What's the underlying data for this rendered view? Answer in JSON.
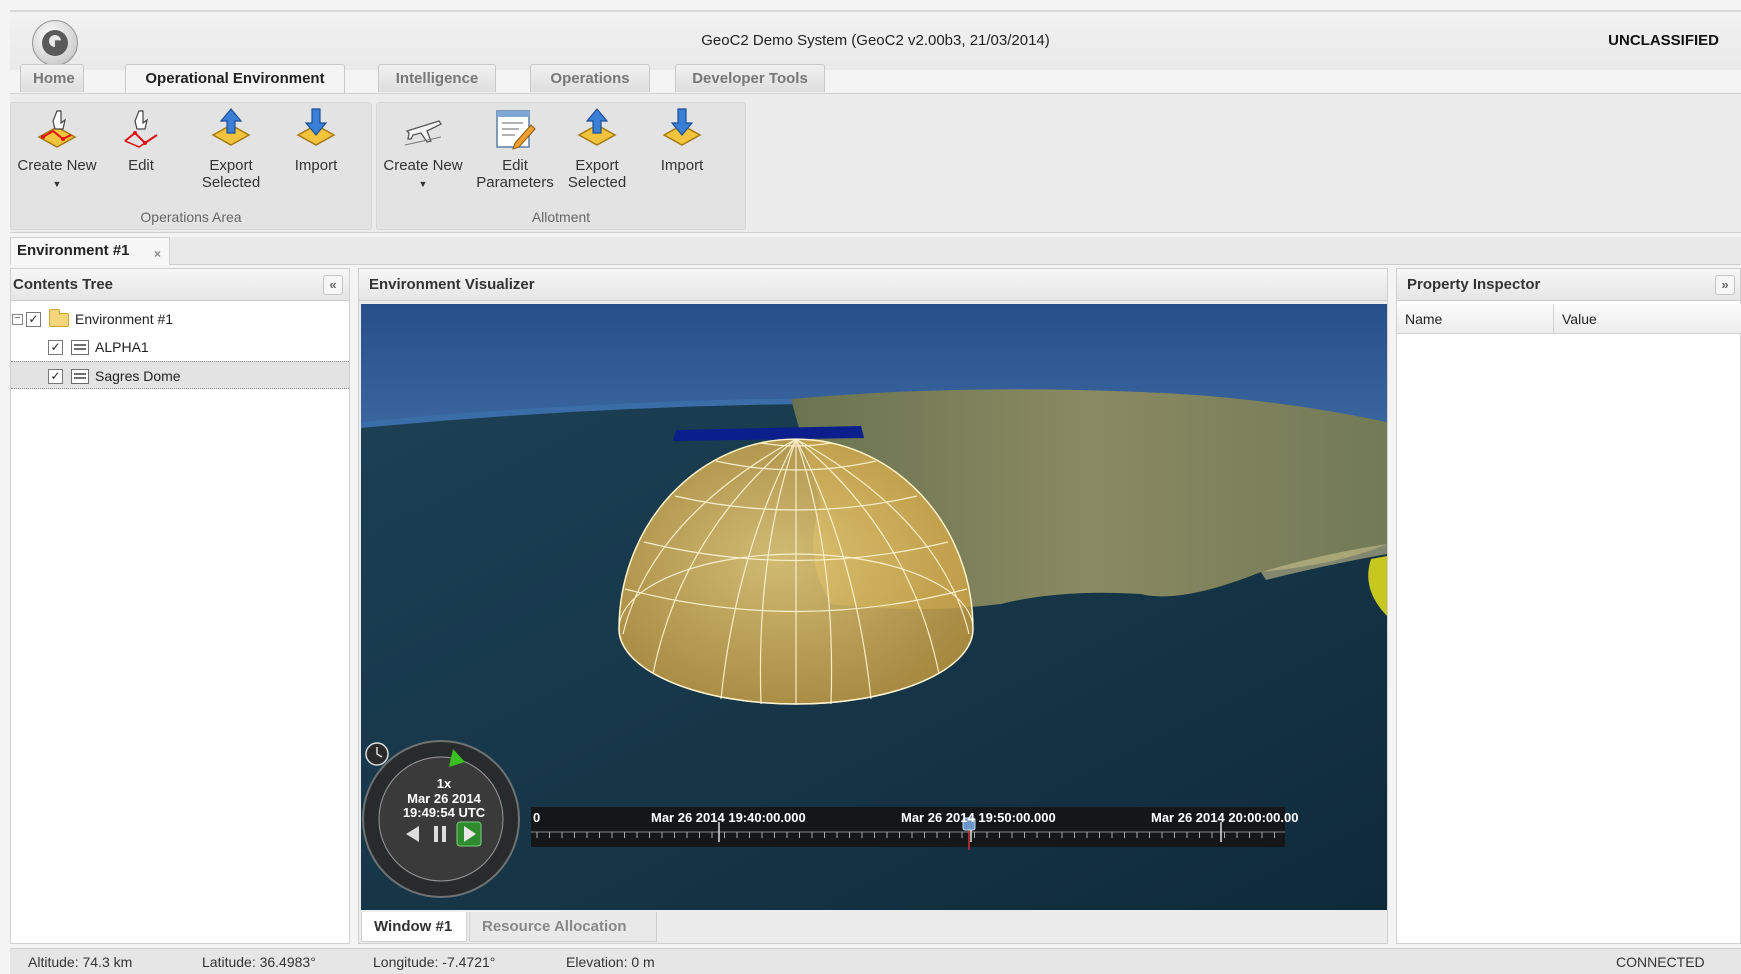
{
  "app": {
    "title": "GeoC2 Demo System (GeoC2 v2.00b3, 21/03/2014)",
    "classification": "UNCLASSIFIED"
  },
  "main_tabs": [
    {
      "label": "Home",
      "active": false
    },
    {
      "label": "Operational Environment",
      "active": true
    },
    {
      "label": "Intelligence",
      "active": false
    },
    {
      "label": "Operations",
      "active": false
    },
    {
      "label": "Developer Tools",
      "active": false
    }
  ],
  "ribbon": {
    "groups": [
      {
        "label": "Operations Area",
        "buttons": [
          {
            "label": "Create New",
            "icon": "create-area-icon",
            "has_dropdown": true
          },
          {
            "label": "Edit",
            "icon": "edit-area-icon"
          },
          {
            "label": "Export Selected",
            "line1": "Export",
            "line2": "Selected",
            "icon": "export-icon"
          },
          {
            "label": "Import",
            "icon": "import-icon"
          }
        ]
      },
      {
        "label": "Allotment",
        "buttons": [
          {
            "label": "Create New",
            "icon": "aircraft-icon",
            "has_dropdown": true
          },
          {
            "label": "Edit Parameters",
            "line1": "Edit",
            "line2": "Parameters",
            "icon": "edit-parameters-icon"
          },
          {
            "label": "Export Selected",
            "line1": "Export",
            "line2": "Selected",
            "icon": "export-icon"
          },
          {
            "label": "Import",
            "icon": "import-icon"
          }
        ]
      }
    ]
  },
  "document_tab": {
    "label": "Environment #1",
    "close": "×"
  },
  "contents_tree": {
    "title": "Contents Tree",
    "collapse": "«",
    "items": [
      {
        "label": "Environment #1",
        "checked": true,
        "expanded": true,
        "icon": "folder-icon",
        "expander": "−"
      },
      {
        "label": "ALPHA1",
        "checked": true,
        "icon": "document-icon"
      },
      {
        "label": "Sagres Dome",
        "checked": true,
        "icon": "document-icon",
        "selected": true
      }
    ],
    "check": "✓"
  },
  "visualizer": {
    "title": "Environment Visualizer",
    "clock": {
      "speed": "1x",
      "date": "Mar 26 2014",
      "time": "19:49:54 UTC"
    },
    "timeline": {
      "edge": "0",
      "labels": [
        "Mar 26 2014 19:40:00.000",
        "Mar 26 2014 19:50:00.000",
        "Mar 26 2014 20:00:00.00"
      ]
    },
    "tabs": [
      {
        "label": "Window #1",
        "active": true
      },
      {
        "label": "Resource Allocation",
        "active": false
      }
    ]
  },
  "property_inspector": {
    "title": "Property Inspector",
    "expand": "»",
    "columns": [
      "Name",
      "Value"
    ]
  },
  "status": {
    "altitude": "Altitude: 74.3 km",
    "latitude": "Latitude: 36.4983°",
    "longitude": "Longitude: -7.4721°",
    "elevation": "Elevation: 0 m",
    "connection": "CONNECTED"
  },
  "colors": {
    "dome": "#e8c85a",
    "sky": "#3a6aa8",
    "ocean": "#18384c",
    "land": "#7a7a52",
    "zone": "#0a1e8c",
    "active_play": "#2e8b2e"
  }
}
